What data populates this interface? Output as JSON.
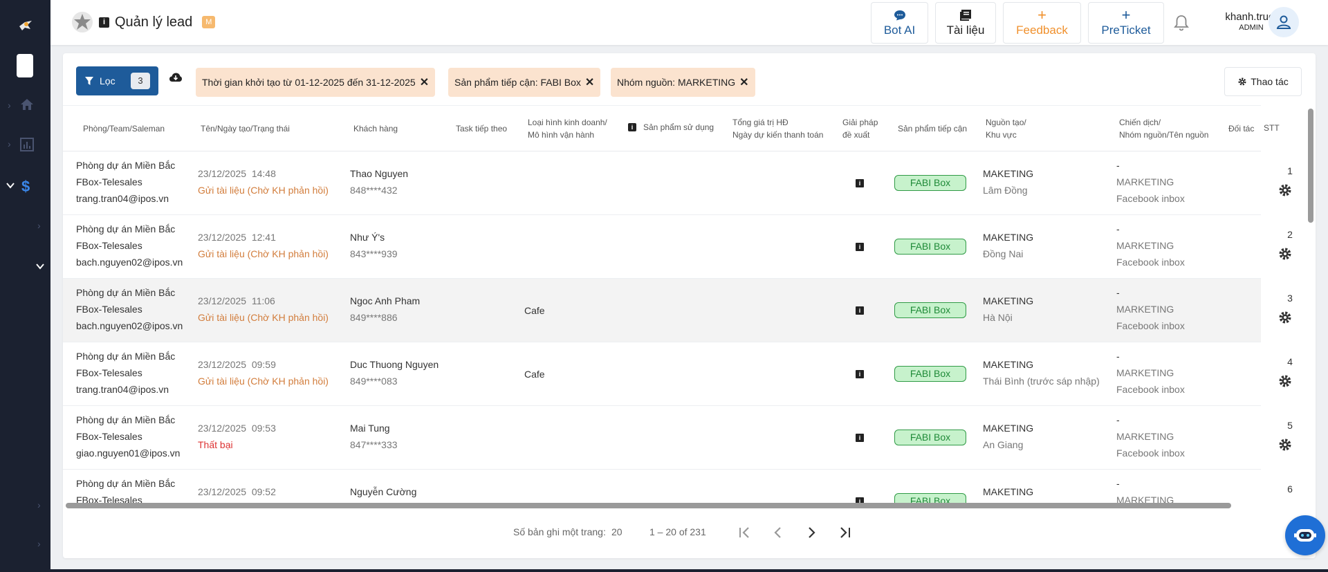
{
  "app": {
    "title": "Quản lý lead",
    "title_badge": "M"
  },
  "header": {
    "buttons": [
      {
        "label": "Bot AI",
        "icon": "chat-bubble-icon",
        "color": "#1e5b9a"
      },
      {
        "label": "Tài liệu",
        "icon": "book-icon",
        "color": "#222222"
      },
      {
        "label": "Feedback",
        "icon": "plus-icon",
        "color": "#f0902c"
      },
      {
        "label": "PreTicket",
        "icon": "plus-icon",
        "color": "#1e5b9a"
      }
    ],
    "user": {
      "name": "khanh.truong",
      "role": "ADMIN"
    }
  },
  "filters": {
    "button_label": "Lọc",
    "count": "3",
    "chips": [
      "Thời gian khởi tạo từ 01-12-2025 đến 31-12-2025",
      "Sản phẩm tiếp cận: FABI Box",
      "Nhóm nguồn: MARKETING"
    ],
    "action_label": "Thao tác"
  },
  "table": {
    "headers": {
      "team": "Phòng/Team/Saleman",
      "name": "Tên/Ngày tạo/Trạng thái",
      "customer": "Khách hàng",
      "task": "Task tiếp theo",
      "biz1": "Loại hình kinh doanh/",
      "biz2": "Mô hình vận hành",
      "product": "Sản phẩm sử dụng",
      "total1": "Tổng giá trị HĐ",
      "total2": "Ngày dự kiến thanh toán",
      "sol1": "Giải pháp",
      "sol2": "đề xuất",
      "approach": "Sản phẩm tiếp cận",
      "src1": "Nguồn tạo/",
      "src2": "Khu vực",
      "camp1": "Chiến dịch/",
      "camp2": "Nhóm nguồn/Tên nguồn",
      "partner": "Đối tác",
      "stt": "STT"
    },
    "rows": [
      {
        "team": [
          "Phòng dự án Miền Bắc",
          "FBox-Telesales",
          "trang.tran04@ipos.vn"
        ],
        "date": "23/12/2025  14:48",
        "status": "Gửi tài liệu (Chờ KH phản hồi)",
        "status_type": "orange",
        "customer": "Thao Nguyen",
        "phone": "848****432",
        "biz": "",
        "approach": "FABI Box",
        "source": "MAKETING",
        "region": "Lâm Đồng",
        "campaign": [
          "-",
          "MARKETING",
          "Facebook inbox"
        ],
        "stt": "1"
      },
      {
        "team": [
          "Phòng dự án Miền Bắc",
          "FBox-Telesales",
          "bach.nguyen02@ipos.vn"
        ],
        "date": "23/12/2025  12:41",
        "status": "Gửi tài liệu (Chờ KH phản hồi)",
        "status_type": "orange",
        "customer": "Như Ý's",
        "phone": "843****939",
        "biz": "",
        "approach": "FABI Box",
        "source": "MAKETING",
        "region": "Đồng Nai",
        "campaign": [
          "-",
          "MARKETING",
          "Facebook inbox"
        ],
        "stt": "2"
      },
      {
        "team": [
          "Phòng dự án Miền Bắc",
          "FBox-Telesales",
          "bach.nguyen02@ipos.vn"
        ],
        "date": "23/12/2025  11:06",
        "status": "Gửi tài liệu (Chờ KH phản hồi)",
        "status_type": "orange",
        "customer": "Ngoc Anh Pham",
        "phone": "849****886",
        "biz": "Cafe",
        "approach": "FABI Box",
        "source": "MAKETING",
        "region": "Hà Nội",
        "campaign": [
          "-",
          "MARKETING",
          "Facebook inbox"
        ],
        "stt": "3"
      },
      {
        "team": [
          "Phòng dự án Miền Bắc",
          "FBox-Telesales",
          "trang.tran04@ipos.vn"
        ],
        "date": "23/12/2025  09:59",
        "status": "Gửi tài liệu (Chờ KH phản hồi)",
        "status_type": "orange",
        "customer": "Duc Thuong Nguyen",
        "phone": "849****083",
        "biz": "Cafe",
        "approach": "FABI Box",
        "source": "MAKETING",
        "region": "Thái Bình (trước sáp nhập)",
        "campaign": [
          "-",
          "MARKETING",
          "Facebook inbox"
        ],
        "stt": "4"
      },
      {
        "team": [
          "Phòng dự án Miền Bắc",
          "FBox-Telesales",
          "giao.nguyen01@ipos.vn"
        ],
        "date": "23/12/2025  09:53",
        "status": "Thất bại",
        "status_type": "red",
        "customer": "Mai Tung",
        "phone": "847****333",
        "biz": "",
        "approach": "FABI Box",
        "source": "MAKETING",
        "region": "An Giang",
        "campaign": [
          "-",
          "MARKETING",
          "Facebook inbox"
        ],
        "stt": "5"
      },
      {
        "team": [
          "Phòng dự án Miền Bắc",
          "FBox-Telesales",
          ""
        ],
        "date": "23/12/2025  09:52",
        "status": "",
        "status_type": "orange",
        "customer": "Nguyễn Cường",
        "phone": "",
        "biz": "",
        "approach": "FABI Box",
        "source": "MAKETING",
        "region": "",
        "campaign": [
          "-",
          "MARKETING",
          ""
        ],
        "stt": "6"
      }
    ]
  },
  "pager": {
    "per_page_label": "Số bản ghi một trang:",
    "per_page": "20",
    "range": "1 – 20 of 231"
  },
  "colors": {
    "sidebar": "#1b2130",
    "primary": "#1e5b9a",
    "chip_bg": "#fbe3cf",
    "tag_bg": "#c7f2cc",
    "tag_border": "#2f9a45",
    "orange_status": "#d27d3c"
  }
}
